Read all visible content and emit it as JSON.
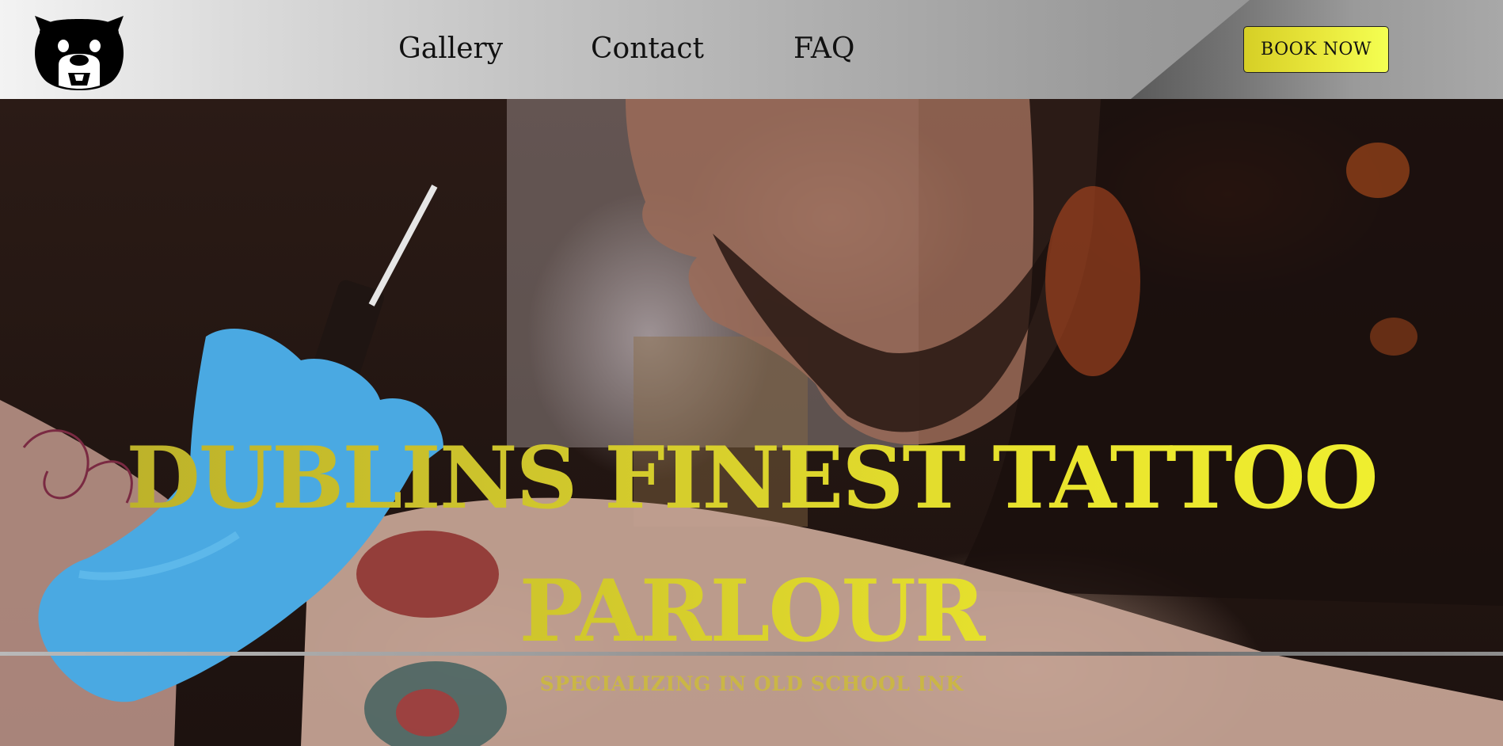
{
  "header": {
    "logo_icon": "bulldog-icon",
    "nav": [
      {
        "label": "Gallery"
      },
      {
        "label": "Contact"
      },
      {
        "label": "FAQ"
      }
    ],
    "cta_label": "BOOK NOW"
  },
  "hero": {
    "title": "DUBLINS FINEST TATTOO PARLOUR",
    "tagline": "SPECIALIZING IN OLD SCHOOL INK",
    "accent_color": "#e6e22e"
  }
}
